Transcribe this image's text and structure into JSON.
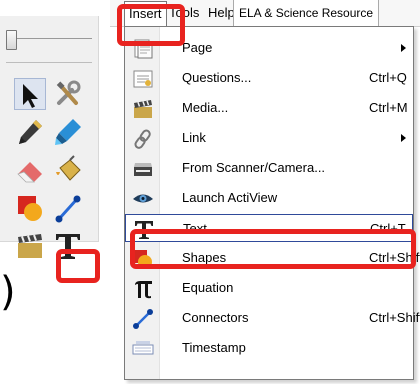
{
  "menubar": {
    "insert": "Insert",
    "tools": "Tools",
    "help": "Help",
    "resource": "ELA & Science Resource"
  },
  "dropdown": {
    "items": [
      {
        "label": "Page",
        "shortcut": "",
        "submenu": true,
        "icon": "page-icon"
      },
      {
        "label": "Questions...",
        "shortcut": "Ctrl+Q",
        "submenu": false,
        "icon": "questions-icon"
      },
      {
        "label": "Media...",
        "shortcut": "Ctrl+M",
        "submenu": false,
        "icon": "media-clapper-icon"
      },
      {
        "label": "Link",
        "shortcut": "",
        "submenu": true,
        "icon": "link-chain-icon"
      },
      {
        "label": "From Scanner/Camera...",
        "shortcut": "",
        "submenu": false,
        "icon": "scanner-icon"
      },
      {
        "label": "Launch ActiView",
        "shortcut": "",
        "submenu": false,
        "icon": "eye-icon"
      },
      {
        "label": "Text",
        "shortcut": "Ctrl+T",
        "submenu": false,
        "icon": "text-t-icon"
      },
      {
        "label": "Shapes",
        "shortcut": "Ctrl+Shift+S",
        "submenu": false,
        "icon": "shapes-icon"
      },
      {
        "label": "Equation",
        "shortcut": "",
        "submenu": false,
        "icon": "pi-equation-icon"
      },
      {
        "label": "Connectors",
        "shortcut": "Ctrl+Shift+C",
        "submenu": false,
        "icon": "connector-icon"
      },
      {
        "label": "Timestamp",
        "shortcut": "",
        "submenu": false,
        "icon": "timestamp-icon"
      }
    ]
  },
  "toolbox": {
    "paren": ")",
    "tools": [
      "select-arrow-icon",
      "tools-wrench-icon",
      "pen-icon",
      "highlighter-icon",
      "eraser-icon",
      "fill-bucket-icon",
      "shapes-icon",
      "connector-icon",
      "media-clapper-icon",
      "text-t-icon"
    ]
  },
  "colors": {
    "highlight": "#e8231f",
    "hover_border": "#2f4a9a"
  }
}
